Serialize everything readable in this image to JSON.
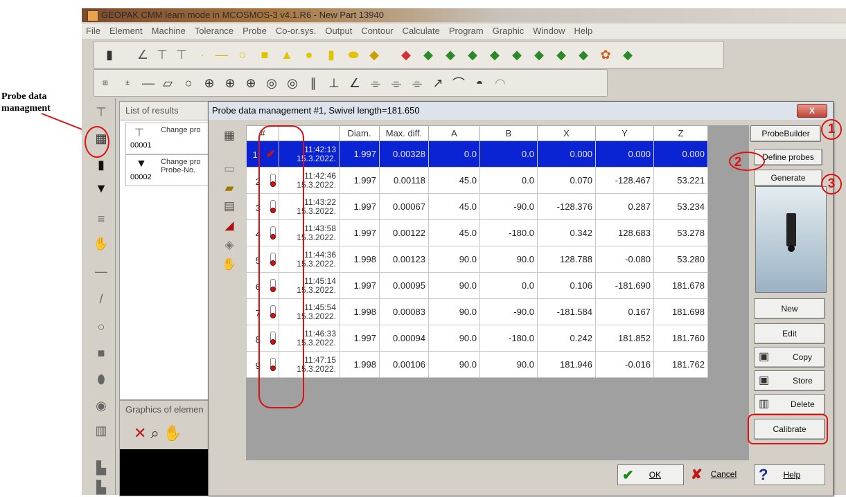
{
  "annotation": {
    "label": "Probe data managment"
  },
  "app": {
    "title": "GEOPAK CMM learn mode in MCOSMOS-3 v4.1.R6  - New Part 13940"
  },
  "menu": [
    "File",
    "Element",
    "Machine",
    "Tolerance",
    "Probe",
    "Co-or.sys.",
    "Output",
    "Contour",
    "Calculate",
    "Program",
    "Graphic",
    "Window",
    "Help"
  ],
  "results": {
    "title": "List of results",
    "items": [
      {
        "num": "00001",
        "text": "Change pro"
      },
      {
        "num": "00002",
        "text": "Change pro Probe-No."
      }
    ]
  },
  "graphics": {
    "title": "Graphics of elemen"
  },
  "dialog": {
    "title": "Probe data management #1, Swivel length=181.650",
    "close": "X",
    "columns": [
      "#",
      "",
      "Diam.",
      "Max. diff.",
      "A",
      "B",
      "X",
      "Y",
      "Z"
    ],
    "rows": [
      {
        "n": "1",
        "time": "11:42:13",
        "date": "15.3.2022.",
        "diam": "1.997",
        "maxdiff": "0.00328",
        "a": "0.0",
        "b": "0.0",
        "x": "0.000",
        "y": "0.000",
        "z": "0.000",
        "selected": true
      },
      {
        "n": "2",
        "time": "11:42:46",
        "date": "15.3.2022.",
        "diam": "1.997",
        "maxdiff": "0.00118",
        "a": "45.0",
        "b": "0.0",
        "x": "0.070",
        "y": "-128.467",
        "z": "53.221"
      },
      {
        "n": "3",
        "time": "11:43:22",
        "date": "15.3.2022.",
        "diam": "1.997",
        "maxdiff": "0.00067",
        "a": "45.0",
        "b": "-90.0",
        "x": "-128.376",
        "y": "0.287",
        "z": "53.234"
      },
      {
        "n": "4",
        "time": "11:43:58",
        "date": "15.3.2022.",
        "diam": "1.997",
        "maxdiff": "0.00122",
        "a": "45.0",
        "b": "-180.0",
        "x": "0.342",
        "y": "128.683",
        "z": "53.278"
      },
      {
        "n": "5",
        "time": "11:44:36",
        "date": "15.3.2022.",
        "diam": "1.998",
        "maxdiff": "0.00123",
        "a": "90.0",
        "b": "90.0",
        "x": "128.788",
        "y": "-0.080",
        "z": "53.280"
      },
      {
        "n": "6",
        "time": "11:45:14",
        "date": "15.3.2022.",
        "diam": "1.997",
        "maxdiff": "0.00095",
        "a": "90.0",
        "b": "0.0",
        "x": "0.106",
        "y": "-181.690",
        "z": "181.678"
      },
      {
        "n": "7",
        "time": "11:45:54",
        "date": "15.3.2022.",
        "diam": "1.998",
        "maxdiff": "0.00083",
        "a": "90.0",
        "b": "-90.0",
        "x": "-181.584",
        "y": "0.167",
        "z": "181.698"
      },
      {
        "n": "8",
        "time": "11:46:33",
        "date": "15.3.2022.",
        "diam": "1.997",
        "maxdiff": "0.00094",
        "a": "90.0",
        "b": "-180.0",
        "x": "0.242",
        "y": "181.852",
        "z": "181.760"
      },
      {
        "n": "9",
        "time": "11:47:15",
        "date": "15.3.2022.",
        "diam": "1.998",
        "maxdiff": "0.00106",
        "a": "90.0",
        "b": "90.0",
        "x": "181.946",
        "y": "-0.016",
        "z": "181.762"
      }
    ],
    "buttons": {
      "probebuilder": "ProbeBuilder",
      "define": "Define probes",
      "generate": "Generate",
      "new": "New",
      "edit": "Edit",
      "copy": "Copy",
      "store": "Store",
      "delete": "Delete",
      "calibrate": "Calibrate",
      "ok": "OK",
      "cancel": "Cancel",
      "help": "Help"
    },
    "callouts": [
      "1",
      "2",
      "3"
    ]
  },
  "colors": {
    "selection": "#0a24d4",
    "annotation": "#dd1111"
  }
}
